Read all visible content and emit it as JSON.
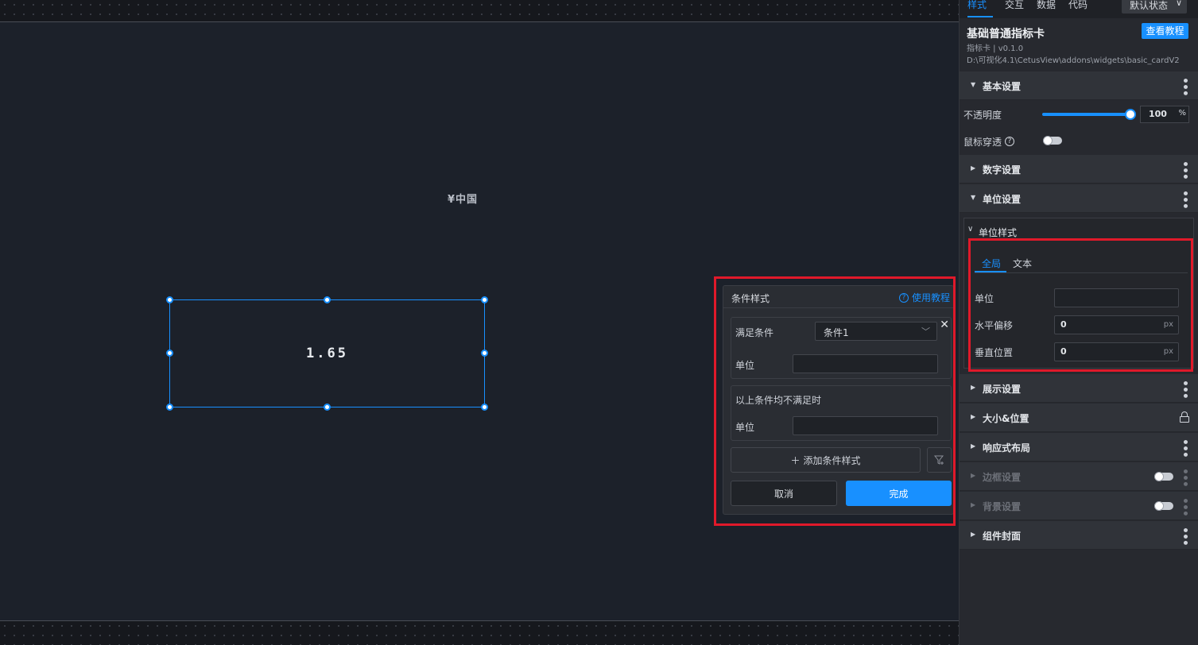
{
  "canvas": {
    "sublabel": "¥中国",
    "card_value": "1.65"
  },
  "popup": {
    "title": "条件样式",
    "help_label": "使用教程",
    "help_icon_glyph": "?",
    "condition_label": "满足条件",
    "condition_selected": "条件1",
    "close_glyph": "✕",
    "unit_label": "单位",
    "fallback_label": "以上条件均不满足时",
    "fallback_unit_label": "单位",
    "add_label": "添加条件样式",
    "add_glyph": "＋",
    "cancel_label": "取消",
    "confirm_label": "完成"
  },
  "panel": {
    "tabs": [
      "样式",
      "交互",
      "数据",
      "代码"
    ],
    "state_button": "默认状态",
    "component_title": "基础普通指标卡",
    "tutorial_button": "查看教程",
    "component_meta": "指标卡 | v0.1.0",
    "component_path": "D:\\可视化4.1\\CetusView\\addons\\widgets\\basic_cardV2",
    "basic": {
      "title": "基本设置",
      "opacity_label": "不透明度",
      "opacity_value": "100",
      "opacity_unit": "%",
      "mouse_through_label": "鼠标穿透",
      "help_glyph": "?"
    },
    "number_section": "数字设置",
    "unit_section": "单位设置",
    "unit_style": {
      "title": "单位样式",
      "tab_global": "全局",
      "tab_text": "文本",
      "unit_label": "单位",
      "unit_value": "",
      "h_offset_label": "水平偏移",
      "h_offset_value": "0",
      "h_offset_unit": "px",
      "v_pos_label": "垂直位置",
      "v_pos_value": "0",
      "v_pos_unit": "px"
    },
    "sections": {
      "display": "展示设置",
      "size_position": "大小&位置",
      "responsive": "响应式布局",
      "border": "边框设置",
      "background": "背景设置",
      "cover": "组件封面"
    }
  },
  "colors": {
    "accent": "#1890ff",
    "highlight_frame": "#e0192a"
  }
}
